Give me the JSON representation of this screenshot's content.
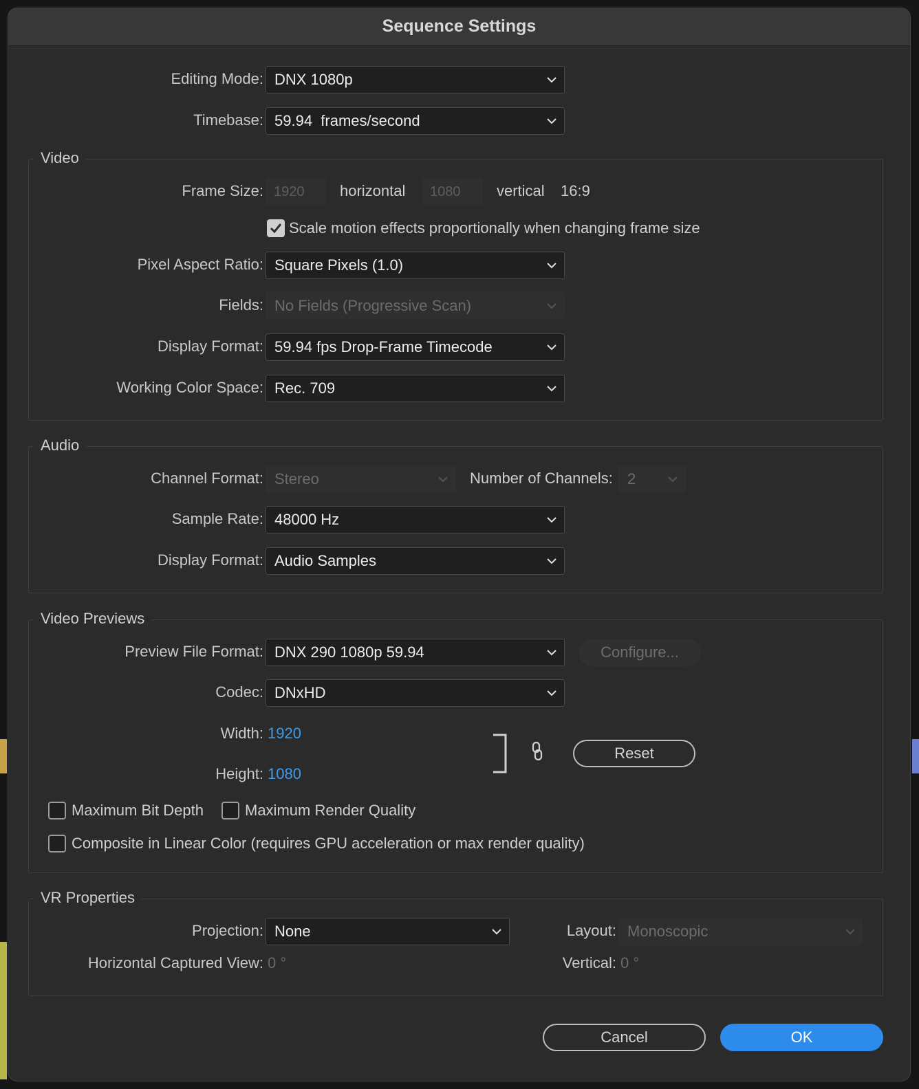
{
  "dialog": {
    "title": "Sequence Settings"
  },
  "top": {
    "editing_mode_label": "Editing Mode:",
    "editing_mode_value": "DNX 1080p",
    "timebase_label": "Timebase:",
    "timebase_value": "59.94  frames/second"
  },
  "video": {
    "title": "Video",
    "frame_size_label": "Frame Size:",
    "frame_width": "1920",
    "horizontal_label": "horizontal",
    "frame_height": "1080",
    "vertical_label": "vertical",
    "aspect": "16:9",
    "scale_motion_label": "Scale motion effects proportionally when changing frame size",
    "scale_motion_checked": true,
    "pixel_aspect_label": "Pixel Aspect Ratio:",
    "pixel_aspect_value": "Square Pixels (1.0)",
    "fields_label": "Fields:",
    "fields_value": "No Fields (Progressive Scan)",
    "display_format_label": "Display Format:",
    "display_format_value": "59.94 fps Drop-Frame Timecode",
    "color_space_label": "Working Color Space:",
    "color_space_value": "Rec. 709"
  },
  "audio": {
    "title": "Audio",
    "channel_format_label": "Channel Format:",
    "channel_format_value": "Stereo",
    "num_channels_label": "Number of Channels:",
    "num_channels_value": "2",
    "sample_rate_label": "Sample Rate:",
    "sample_rate_value": "48000 Hz",
    "display_format_label": "Display Format:",
    "display_format_value": "Audio Samples"
  },
  "previews": {
    "title": "Video Previews",
    "file_format_label": "Preview File Format:",
    "file_format_value": "DNX 290 1080p 59.94",
    "configure_label": "Configure...",
    "codec_label": "Codec:",
    "codec_value": "DNxHD",
    "width_label": "Width:",
    "width_value": "1920",
    "height_label": "Height:",
    "height_value": "1080",
    "reset_label": "Reset",
    "max_bit_depth_label": "Maximum Bit Depth",
    "max_render_quality_label": "Maximum Render Quality",
    "linear_color_label": "Composite in Linear Color (requires GPU acceleration or max render quality)"
  },
  "vr": {
    "title": "VR Properties",
    "projection_label": "Projection:",
    "projection_value": "None",
    "layout_label": "Layout:",
    "layout_value": "Monoscopic",
    "h_view_label": "Horizontal Captured View:",
    "h_view_value": "0 °",
    "vertical_label": "Vertical:",
    "vertical_value": "0 °"
  },
  "footer": {
    "cancel_label": "Cancel",
    "ok_label": "OK"
  },
  "colors": {
    "accent": "#2d8ceb",
    "link_value": "#3a9cf0"
  }
}
